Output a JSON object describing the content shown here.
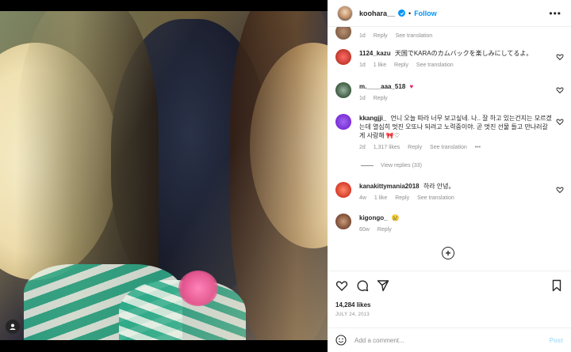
{
  "post": {
    "username": "koohara__",
    "follow_label": "Follow",
    "separator": "•",
    "more_label": "•••"
  },
  "comments": [
    {
      "user": "",
      "text": "",
      "time": "1d",
      "likes": "",
      "reply": "Reply",
      "translate": "See translation",
      "avatar_color": "#8b6a52"
    },
    {
      "user": "1124_kazu",
      "text": "天国でKARAのカムバックを楽しみにしてるよ。",
      "time": "1d",
      "likes": "1 like",
      "reply": "Reply",
      "translate": "See translation",
      "avatar_color": "#c0392b"
    },
    {
      "user": "m.____aaa_518",
      "text": "♥",
      "time": "1d",
      "likes": "",
      "reply": "Reply",
      "translate": "",
      "avatar_color": "#3d5a40"
    },
    {
      "user": "kkangjji_",
      "text": "언니 오늘 따라 너무 보고싶네. 나.. 잘 하고 있는건지는 모르겠는데 열심히 멋진 오또나 되려고 노력중이야. 곧 멋진 선물 들고 만나러갈게 사랑해 🎀♡",
      "time": "2d",
      "likes": "1,317 likes",
      "reply": "Reply",
      "translate": "See translation",
      "more": "•••",
      "avatar_color": "#7a2fd8"
    },
    {
      "user": "kanakittymania2018",
      "text": "하라 안녕。",
      "time": "4w",
      "likes": "1 like",
      "reply": "Reply",
      "translate": "See translation",
      "avatar_color": "#d63a2a"
    },
    {
      "user": "kigongo_",
      "text": "😢",
      "time": "60w",
      "likes": "",
      "reply": "Reply",
      "translate": "",
      "avatar_color": "#7a4a34"
    }
  ],
  "view_replies": "View replies (33)",
  "load_more": "+",
  "likes_text": "14,284 likes",
  "date_text": "JULY 24, 2013",
  "comment_placeholder": "Add a comment...",
  "post_label": "Post"
}
